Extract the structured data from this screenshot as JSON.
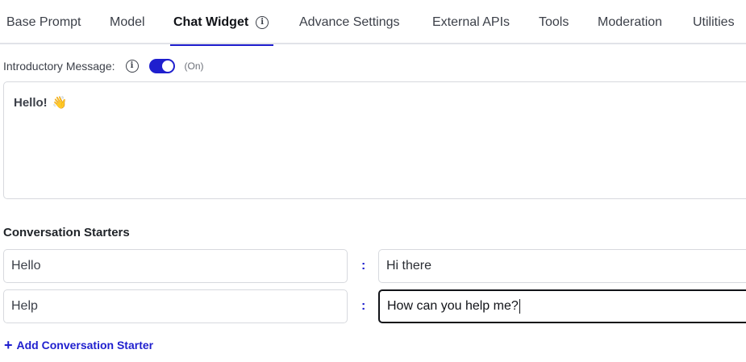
{
  "tabs": [
    {
      "label": "Base Prompt",
      "active": false
    },
    {
      "label": "Model",
      "active": false
    },
    {
      "label": "Chat Widget",
      "active": true
    },
    {
      "label": "Advance Settings",
      "active": false
    },
    {
      "label": "External APIs",
      "active": false
    },
    {
      "label": "Tools",
      "active": false
    },
    {
      "label": "Moderation",
      "active": false
    },
    {
      "label": "Utilities",
      "active": false
    }
  ],
  "intro": {
    "label": "Introductory Message:",
    "toggle_on": true,
    "toggle_state": "(On)",
    "message": "Hello!",
    "message_emoji": "👋"
  },
  "starters": {
    "title": "Conversation Starters",
    "separator": ":",
    "rows": [
      {
        "key": "Hello",
        "value": "Hi there"
      },
      {
        "key": "Help",
        "value": "How can you help me?"
      }
    ],
    "add_label": "Add Conversation Starter"
  },
  "colors": {
    "accent": "#1f1fce",
    "border": "#d7d9de",
    "text": "#3c4049"
  }
}
